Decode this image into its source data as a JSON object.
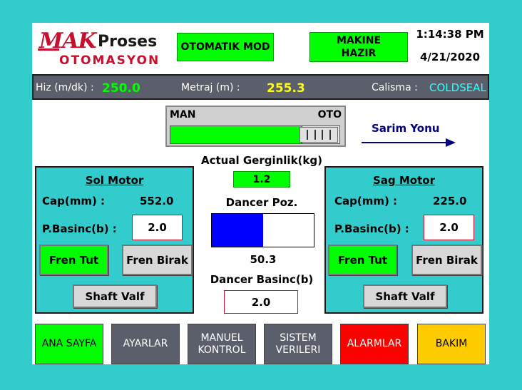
{
  "header": {
    "logo_mak": "MAK",
    "logo_proses": "Proses",
    "logo_otomasyon": "OTOMASYON",
    "mode": "OTOMATIK MOD",
    "machine_status": "MAKINE\nHAZIR",
    "time": "1:14:38 PM",
    "date": "4/21/2020"
  },
  "status": {
    "speed_label": "Hiz (m/dk) :",
    "speed_value": "250.0",
    "meter_label": "Metraj (m) :",
    "meter_value": "255.3",
    "work_label": "Calisma :",
    "work_value": "COLDSEAL"
  },
  "mode_switch": {
    "man_label": "MAN",
    "oto_label": "OTO",
    "fill_fraction": 0.78
  },
  "direction": {
    "label": "Sarim Yonu"
  },
  "center": {
    "tension_label": "Actual Gerginlik(kg)",
    "tension_value": "1.2",
    "dancer_pos_label": "Dancer Poz.",
    "dancer_pos_fraction": 0.5,
    "dancer_pos_value": "50.3",
    "dancer_pressure_label": "Dancer Basinc(b)",
    "dancer_pressure_value": "2.0"
  },
  "left_motor": {
    "title": "Sol Motor",
    "cap_label": "Cap(mm) :",
    "cap_value": "552.0",
    "pressure_label": "P.Basinc(b) :",
    "pressure_value": "2.0",
    "brake_hold": "Fren Tut",
    "brake_release": "Fren Birak",
    "shaft_valve": "Shaft Valf"
  },
  "right_motor": {
    "title": "Sag Motor",
    "cap_label": "Cap(mm) :",
    "cap_value": "225.0",
    "pressure_label": "P.Basinc(b) :",
    "pressure_value": "2.0",
    "brake_hold": "Fren Tut",
    "brake_release": "Fren Birak",
    "shaft_valve": "Shaft Valf"
  },
  "nav": {
    "home": "ANA SAYFA",
    "settings": "AYARLAR",
    "manual": "MANUEL\nKONTROL",
    "system": "SISTEM\nVERILERI",
    "alarms": "ALARMLAR",
    "maintenance": "BAKIM"
  },
  "colors": {
    "background": "#33CCCC",
    "green": "#00FF00",
    "alarm": "#FF0000",
    "maintenance": "#FFCC00",
    "nav_gray": "#5B5E6B",
    "dancer_blue": "#0000FF"
  }
}
